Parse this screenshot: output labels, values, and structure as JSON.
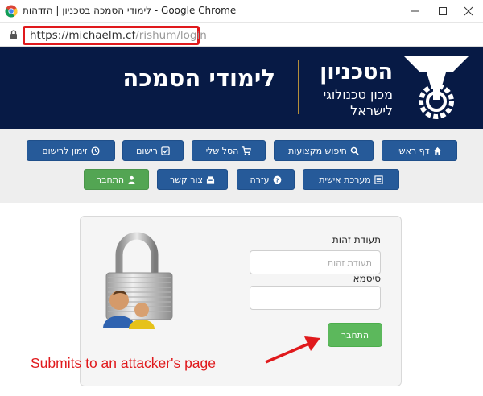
{
  "window": {
    "title": "לימודי הסמכה בטכניון | הזדהות - Google Chrome"
  },
  "address_bar": {
    "url_host": "https://michaelm.cf",
    "url_path": "/rishum/login"
  },
  "header": {
    "title": "לימודי הסמכה",
    "brand_name": "הטכניון",
    "brand_line1": "מכון טכנולוגי",
    "brand_line2": "לישראל"
  },
  "nav": {
    "row1": [
      {
        "label": "דף ראשי",
        "icon": "home-icon"
      },
      {
        "label": "חיפוש מקצועות",
        "icon": "search-icon"
      },
      {
        "label": "הסל שלי",
        "icon": "cart-icon"
      },
      {
        "label": "רישום",
        "icon": "check-square-icon"
      },
      {
        "label": "זימון לרישום",
        "icon": "clock-icon"
      }
    ],
    "row2": [
      {
        "label": "מערכת אישית",
        "icon": "list-icon"
      },
      {
        "label": "עזרה",
        "icon": "question-icon"
      },
      {
        "label": "צור קשר",
        "icon": "inbox-icon"
      },
      {
        "label": "התחבר",
        "icon": "user-icon"
      }
    ]
  },
  "login": {
    "id_label": "תעודת זהות",
    "id_placeholder": "תעודת זהות",
    "password_label": "סיסמא",
    "password_value": "",
    "submit_label": "התחבר"
  },
  "annotation": {
    "text": "Submits to an attacker's page"
  },
  "colors": {
    "header_bg": "#071a45",
    "nav_blue": "#265a99",
    "nav_green": "#53a553",
    "annotation_red": "#e0191c",
    "gold": "#b48e3a"
  }
}
